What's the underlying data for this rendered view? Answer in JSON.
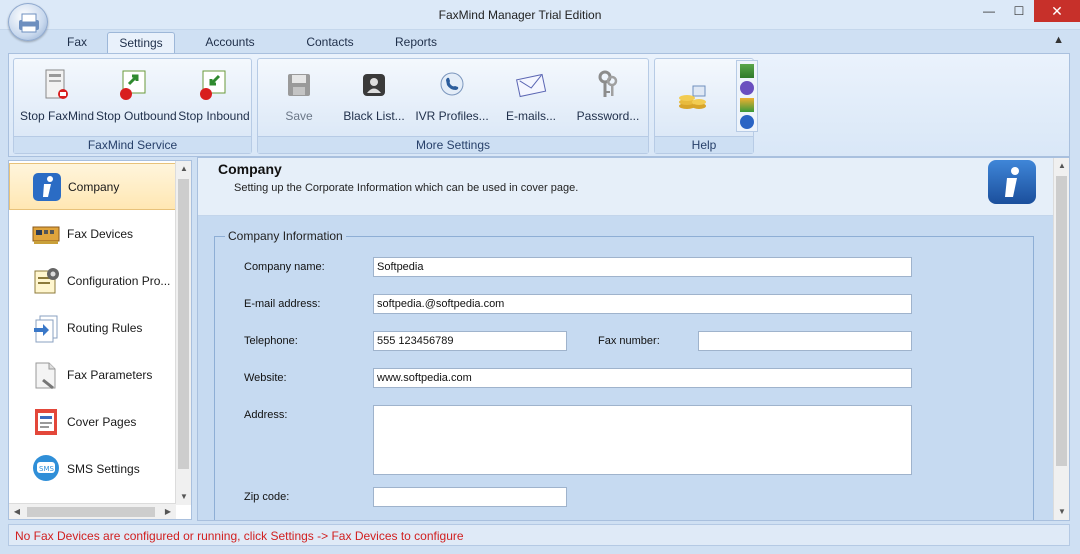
{
  "window": {
    "title": "FaxMind Manager Trial Edition",
    "minimize": "—",
    "maximize": "☐",
    "close": "✕"
  },
  "tabs": [
    {
      "label": "Fax"
    },
    {
      "label": "Settings"
    },
    {
      "label": "Accounts"
    },
    {
      "label": "Contacts"
    },
    {
      "label": "Reports"
    }
  ],
  "ribbon": {
    "collapse": "▲",
    "groups": [
      {
        "label": "FaxMind Service",
        "buttons": [
          "Stop FaxMind",
          "Stop Outbound",
          "Stop Inbound"
        ]
      },
      {
        "label": "More Settings",
        "buttons": [
          "Save",
          "Black List...",
          "IVR Profiles...",
          "E-mails...",
          "Password..."
        ]
      },
      {
        "label": "Help"
      }
    ]
  },
  "nav": {
    "items": [
      {
        "label": "Company"
      },
      {
        "label": "Fax Devices"
      },
      {
        "label": "Configuration  Pro..."
      },
      {
        "label": "Routing Rules"
      },
      {
        "label": "Fax Parameters"
      },
      {
        "label": "Cover Pages"
      },
      {
        "label": "SMS Settings"
      }
    ]
  },
  "content": {
    "title": "Company",
    "description": "Setting up the Corporate Information which can be used in cover page.",
    "section": "Company Information",
    "fields": {
      "company_name": {
        "label": "Company name:",
        "value": "Softpedia"
      },
      "email": {
        "label": "E-mail address:",
        "value": "softpedia.@softpedia.com"
      },
      "telephone": {
        "label": "Telephone:",
        "value": "555 123456789"
      },
      "fax_number": {
        "label": "Fax number:",
        "value": ""
      },
      "website": {
        "label": "Website:",
        "value": "www.softpedia.com"
      },
      "address": {
        "label": "Address:",
        "value": ""
      },
      "zip": {
        "label": "Zip code:",
        "value": ""
      }
    }
  },
  "status": {
    "message": "No Fax Devices are configured or running, click Settings -> Fax Devices to configure"
  },
  "colors": {
    "status_text": "#d12020",
    "active_nav": "#ffe7b3",
    "content_bg": "#c6daf1"
  }
}
